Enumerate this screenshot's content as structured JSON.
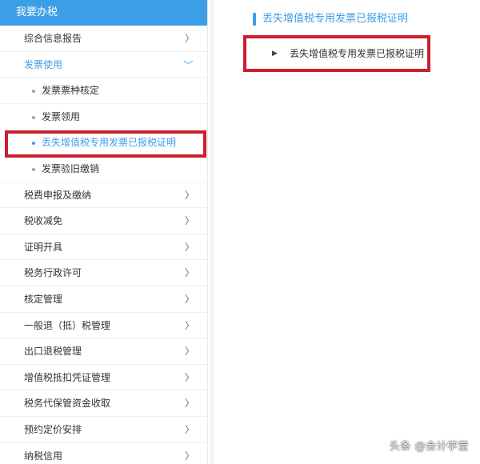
{
  "sidebar": {
    "header": "我要办税",
    "items_top": [
      {
        "label": "综合信息报告",
        "chevron": "〉"
      }
    ],
    "expanded": {
      "label": "发票使用",
      "chevron": "〉"
    },
    "sub_items": [
      {
        "label": "发票票种核定"
      },
      {
        "label": "发票领用"
      },
      {
        "label": "丢失增值税专用发票已报税证明"
      },
      {
        "label": "发票验旧缴销"
      }
    ],
    "items_bottom": [
      {
        "label": "税费申报及缴纳",
        "chevron": "〉"
      },
      {
        "label": "税收减免",
        "chevron": "〉"
      },
      {
        "label": "证明开具",
        "chevron": "〉"
      },
      {
        "label": "税务行政许可",
        "chevron": "〉"
      },
      {
        "label": "核定管理",
        "chevron": "〉"
      },
      {
        "label": "一般退（抵）税管理",
        "chevron": "〉"
      },
      {
        "label": "出口退税管理",
        "chevron": "〉"
      },
      {
        "label": "增值税抵扣凭证管理",
        "chevron": "〉"
      },
      {
        "label": "税务代保管资金收取",
        "chevron": "〉"
      },
      {
        "label": "预约定价安排",
        "chevron": "〉"
      },
      {
        "label": "纳税信用",
        "chevron": "〉"
      }
    ]
  },
  "main": {
    "title": "丢失增值税专用发票已报税证明",
    "link_bullet": "▶",
    "link_label": "丢失增值税专用发票已报税证明"
  },
  "watermark": "头条 @会计学堂",
  "colors": {
    "accent": "#3d9ee8",
    "highlight": "#cc1f2e"
  }
}
